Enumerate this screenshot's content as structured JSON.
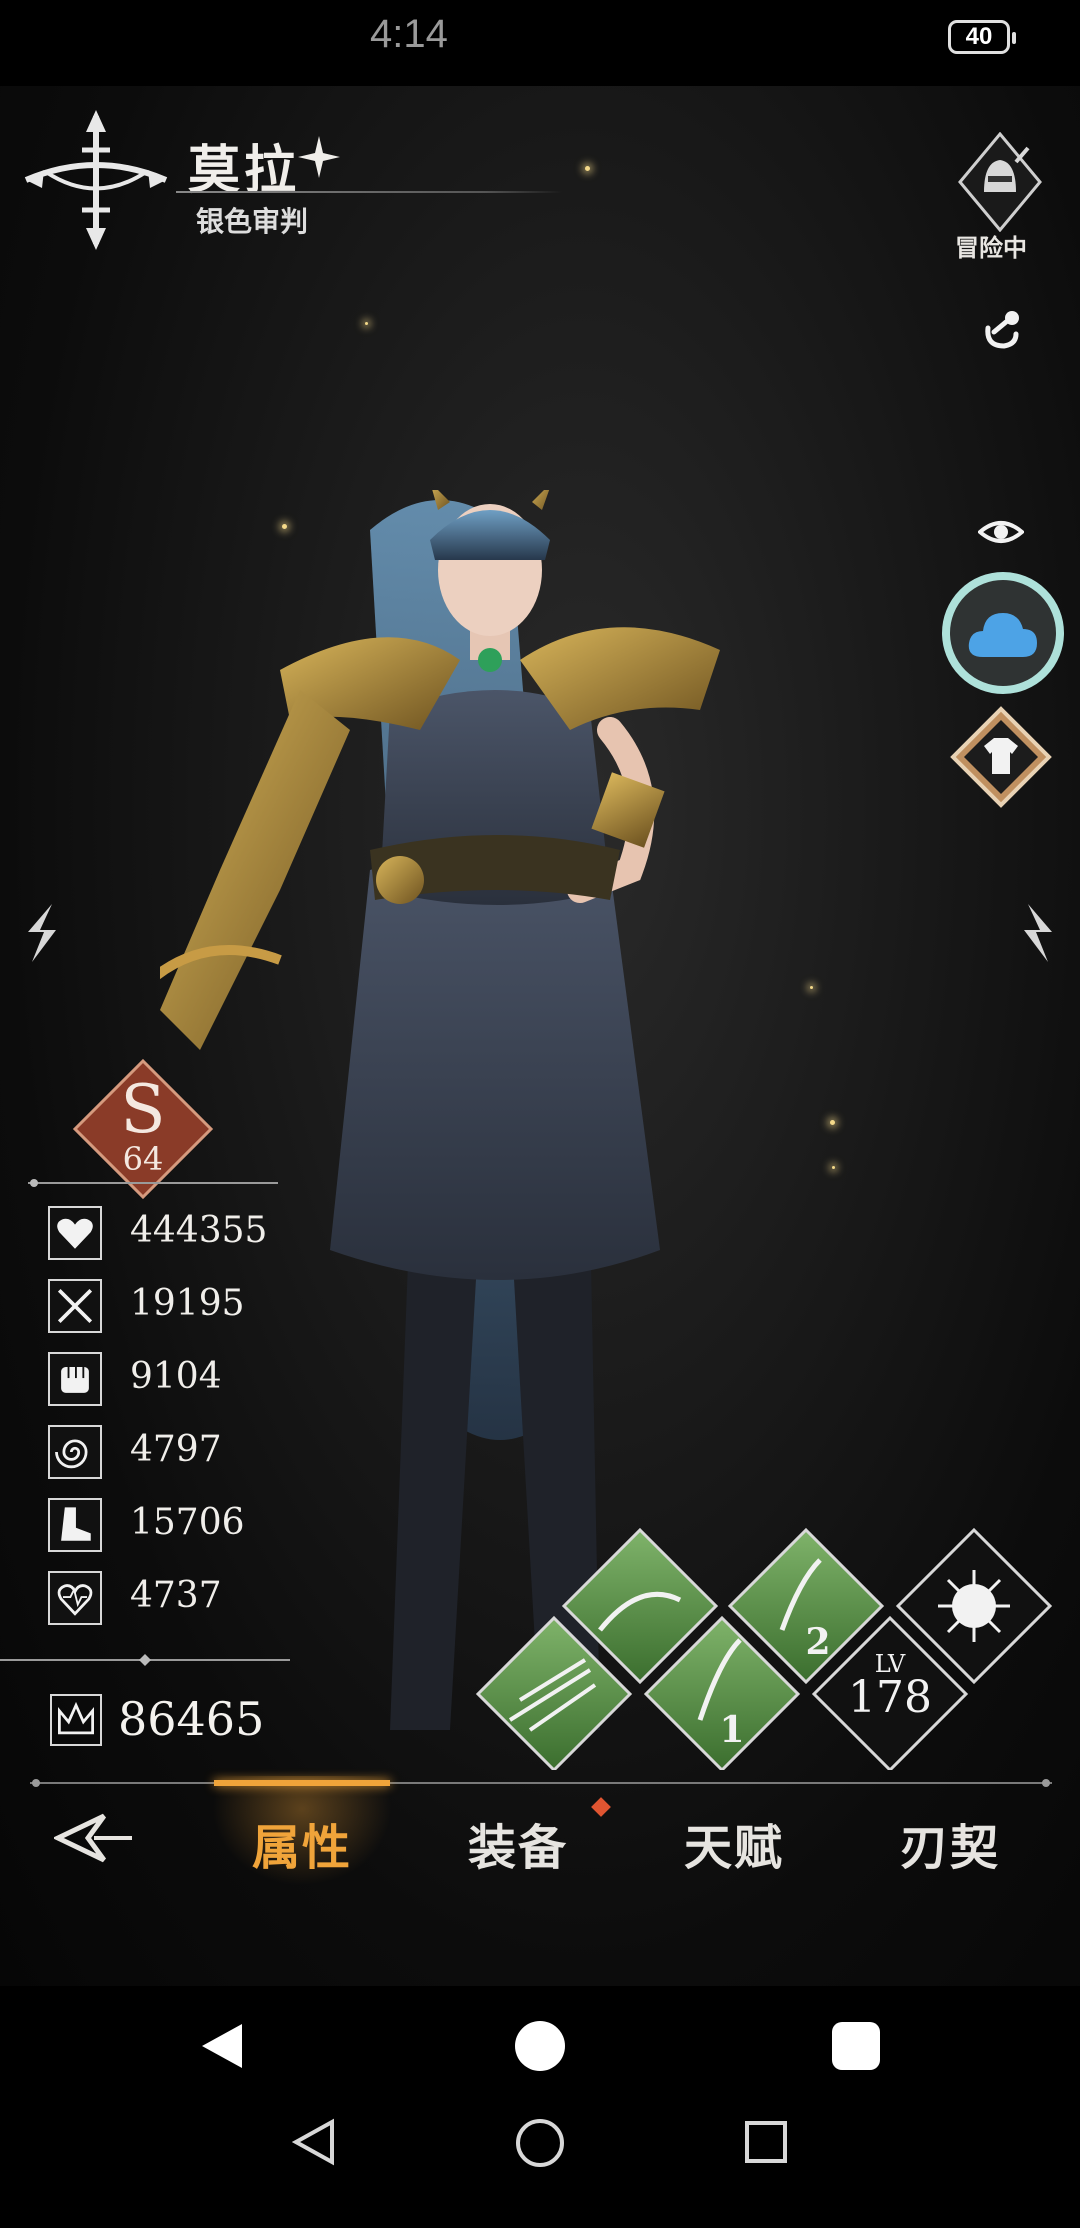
{
  "status_bar": {
    "time": "4:14",
    "battery": "40"
  },
  "hero": {
    "name": "莫拉",
    "title": "银色审判"
  },
  "right_panel": {
    "adventure_label": "冒险中"
  },
  "rank": {
    "letter": "S",
    "level": "64"
  },
  "stats": [
    {
      "icon": "heart-icon",
      "value": "444355"
    },
    {
      "icon": "crossed-swords-icon",
      "value": "19195"
    },
    {
      "icon": "fist-icon",
      "value": "9104"
    },
    {
      "icon": "swirl-icon",
      "value": "4797"
    },
    {
      "icon": "boot-icon",
      "value": "15706"
    },
    {
      "icon": "heart-beat-icon",
      "value": "4737"
    }
  ],
  "power": {
    "icon": "crown-icon",
    "value": "86465"
  },
  "skills": {
    "level_label": "LV",
    "level": "178",
    "slot_1": "1",
    "slot_2": "2"
  },
  "tabs": [
    {
      "label": "属性",
      "active": true
    },
    {
      "label": "装备",
      "active": false,
      "badge": true
    },
    {
      "label": "天赋",
      "active": false
    },
    {
      "label": "刃契",
      "active": false
    }
  ],
  "colors": {
    "accent": "#f0a43a",
    "skill_green": "#4e8a3c",
    "cloud_ring": "#aee1da",
    "cloud_fill": "#4da3e6"
  }
}
